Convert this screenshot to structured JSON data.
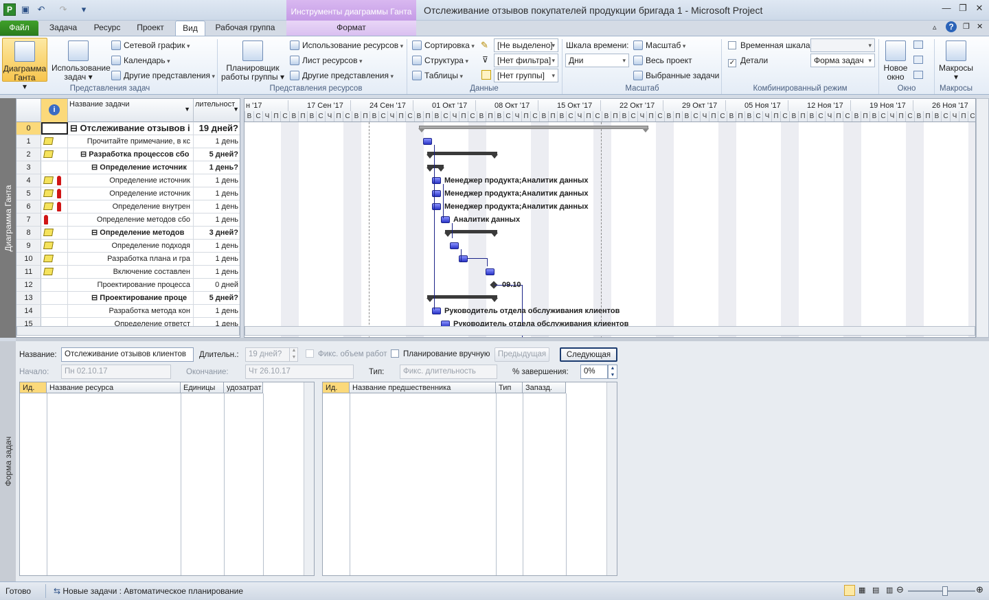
{
  "titlebar": {
    "context_tools": "Инструменты диаграммы Ганта",
    "title": "Отслеживание отзывов покупателей продукции бригада 1  -  Microsoft Project"
  },
  "tabs": [
    "Файл",
    "Задача",
    "Ресурс",
    "Проект",
    "Вид",
    "Рабочая группа",
    "Формат"
  ],
  "ribbon": {
    "gantt": "Диаграмма Ганта",
    "usage": "Использование задач",
    "network": "Сетевой график",
    "calendar": "Календарь",
    "other_views": "Другие представления",
    "grp_task_views": "Представления задач",
    "planner": "Планировщик работы группы",
    "res_usage": "Использование ресурсов",
    "res_sheet": "Лист ресурсов",
    "other_views2": "Другие представления",
    "grp_res_views": "Представления ресурсов",
    "sort": "Сортировка",
    "outline": "Структура",
    "tables": "Таблицы",
    "highlight": "[Не выделено]",
    "filter": "[Нет фильтра]",
    "group": "[Нет группы]",
    "grp_data": "Данные",
    "timescale_label": "Шкала времени:",
    "timescale": "Дни",
    "zoom": "Масштаб",
    "whole": "Весь проект",
    "selected": "Выбранные задачи",
    "grp_zoom": "Масштаб",
    "timeline": "Временная шкала",
    "details": "Детали",
    "details_val": "Форма задач",
    "grp_combo": "Комбинированный режим",
    "new_window": "Новое окно",
    "grp_window": "Окно",
    "macros": "Макросы",
    "grp_macros": "Макросы"
  },
  "side": {
    "top": "Диаграмма Ганта",
    "bottom": "Форма задач"
  },
  "grid": {
    "headers": {
      "name": "Название задачи",
      "dur": "лительност"
    },
    "rows": [
      {
        "id": "0",
        "name": "Отслеживание отзывов і",
        "dur": "19 дней?",
        "level": 0,
        "summary": true,
        "note": false,
        "res": false
      },
      {
        "id": "1",
        "name": "Прочитайте примечание, в кс",
        "dur": "1 день",
        "level": 3,
        "summary": false,
        "note": true,
        "res": false
      },
      {
        "id": "2",
        "name": "Разработка процессов сбо",
        "dur": "5 дней?",
        "level": 1,
        "summary": true,
        "note": true,
        "res": false
      },
      {
        "id": "3",
        "name": "Определение источник",
        "dur": "1 день?",
        "level": 2,
        "summary": true,
        "note": false,
        "res": false
      },
      {
        "id": "4",
        "name": "Определение источник",
        "dur": "1 день",
        "level": 3,
        "summary": false,
        "note": true,
        "res": true
      },
      {
        "id": "5",
        "name": "Определение источник",
        "dur": "1 день",
        "level": 3,
        "summary": false,
        "note": true,
        "res": true
      },
      {
        "id": "6",
        "name": "Определение внутрен",
        "dur": "1 день",
        "level": 3,
        "summary": false,
        "note": true,
        "res": true
      },
      {
        "id": "7",
        "name": "Определение методов сбо",
        "dur": "1 день",
        "level": 2,
        "summary": false,
        "note": false,
        "res": true
      },
      {
        "id": "8",
        "name": "Определение методов",
        "dur": "3 дней?",
        "level": 2,
        "summary": true,
        "note": true,
        "res": false
      },
      {
        "id": "9",
        "name": "Определение подходя",
        "dur": "1 день",
        "level": 3,
        "summary": false,
        "note": true,
        "res": false
      },
      {
        "id": "10",
        "name": "Разработка плана и гра",
        "dur": "1 день",
        "level": 3,
        "summary": false,
        "note": true,
        "res": false
      },
      {
        "id": "11",
        "name": "Включение составлен",
        "dur": "1 день",
        "level": 3,
        "summary": false,
        "note": true,
        "res": false
      },
      {
        "id": "12",
        "name": "Проектирование процесса",
        "dur": "0 дней",
        "level": 2,
        "summary": false,
        "note": false,
        "res": false
      },
      {
        "id": "13",
        "name": "Проектирование проце",
        "dur": "5 дней?",
        "level": 2,
        "summary": true,
        "note": false,
        "res": false
      },
      {
        "id": "14",
        "name": "Разработка метода кон",
        "dur": "1 день",
        "level": 3,
        "summary": false,
        "note": false,
        "res": false
      },
      {
        "id": "15",
        "name": "Определение ответст",
        "dur": "1 день",
        "level": 3,
        "summary": false,
        "note": false,
        "res": false
      }
    ]
  },
  "chart": {
    "weeks": [
      "н '17",
      "17 Сен '17",
      "24 Сен '17",
      "01 Окт '17",
      "08 Окт '17",
      "15 Окт '17",
      "22 Окт '17",
      "29 Окт '17",
      "05 Ноя '17",
      "12 Ноя '17",
      "19 Ноя '17",
      "26 Ноя '17"
    ],
    "days": [
      "В",
      "С",
      "Ч",
      "П",
      "С",
      "В",
      "П"
    ],
    "labels": [
      "Менеджер продукта;Аналитик данных",
      "Менеджер продукта;Аналитик данных",
      "Менеджер продукта;Аналитик данных",
      "Аналитик данных",
      "09.10",
      "Руководитель отдела обслуживания клиентов",
      "Руководитель отдела обслуживания клиентов"
    ]
  },
  "form": {
    "name_label": "Название:",
    "name_val": "Отслеживание отзывов клиентов",
    "dur_label": "Длительн.:",
    "dur_val": "19 дней?",
    "fixed_work": "Фикс. объем работ",
    "manual": "Планирование вручную",
    "prev": "Предыдущая",
    "next": "Следующая",
    "start_label": "Начало:",
    "start_val": "Пн 02.10.17",
    "finish_label": "Окончание:",
    "finish_val": "Чт 26.10.17",
    "type_label": "Тип:",
    "type_val": "Фикс. длительность",
    "pct_label": "% завершения:",
    "pct_val": "0%",
    "res_cols": [
      "Ид.",
      "Название ресурса",
      "Единицы",
      "удозатрат"
    ],
    "pred_cols": [
      "Ид.",
      "Название предшественника",
      "Тип",
      "Запазд."
    ]
  },
  "status": {
    "ready": "Готово",
    "mode": "Новые задачи : Автоматическое планирование"
  }
}
